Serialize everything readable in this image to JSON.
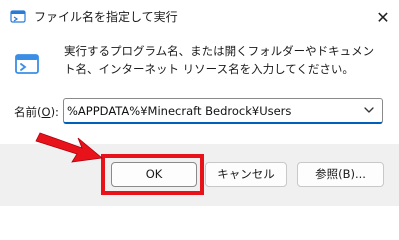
{
  "window": {
    "title": "ファイル名を指定して実行",
    "close_glyph": "✕"
  },
  "main": {
    "description": "実行するプログラム名、または開くフォルダーやドキュメント名、インターネット リソース名を入力してください。",
    "open_label_prefix": "名前(",
    "open_label_key": "O",
    "open_label_suffix": "):",
    "open_value": "%APPDATA%¥Minecraft Bedrock¥Users"
  },
  "buttons": {
    "ok": "OK",
    "cancel": "キャンセル",
    "browse": "参照(B)..."
  },
  "annotation": {
    "highlight_color": "#e8121a"
  },
  "icons": {
    "app": "run-dialog-icon",
    "run": "run-window-icon",
    "dropdown": "chevron-down-icon",
    "close": "close-icon",
    "arrow": "red-pointer-arrow"
  }
}
